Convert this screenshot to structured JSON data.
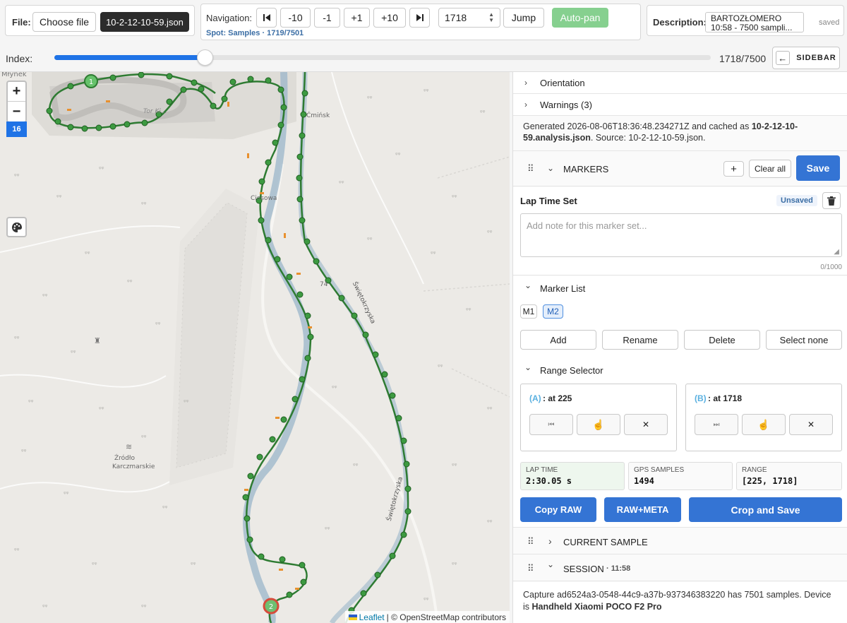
{
  "file": {
    "label": "File:",
    "choose_label": "Choose file",
    "filename": "10-2-12-10-59.json"
  },
  "nav": {
    "label": "Navigation:",
    "minus10": "-10",
    "minus1": "-1",
    "plus1": "+1",
    "plus10": "+10",
    "index_value": "1718",
    "jump": "Jump",
    "autopan": "Auto-pan",
    "spot": "Spot: Samples · 1719/7501"
  },
  "description": {
    "label": "Description:",
    "value": "BARTOZŁOMERO\n10:58 - 7500 sampli...",
    "status": "saved"
  },
  "index": {
    "label": "Index:",
    "position": "1718/7500",
    "fraction": 0.229,
    "sidebar_label": "SIDEBAR"
  },
  "map": {
    "zoom_level": "16",
    "attribution_leaflet": "Leaflet",
    "attribution_osm": "| © OpenStreetMap contributors",
    "marker1": "1",
    "marker2": "2",
    "places": {
      "mlynek": "Młynek",
      "tor": "Tor Ki...",
      "cminsk": "Ćmińsk",
      "ciosowa": "Ciosowa",
      "zrodlo": "Źródło",
      "karczmarskie": "Karczmarskie",
      "road1": "Świętokrzyska",
      "road2": "Świętokrzyska",
      "road74": "74"
    }
  },
  "sidebar": {
    "orientation": "Orientation",
    "warnings": "Warnings (3)",
    "generated_prefix": "Generated 2026-08-06T18:36:48.234271Z and cached as ",
    "generated_bold": "10-2-12-10-59.analysis.json",
    "generated_suffix": ". Source: 10-2-12-10-59.json.",
    "markers": {
      "title": "MARKERS",
      "add": "+",
      "clear": "Clear all",
      "save": "Save",
      "set_title": "Lap Time Set",
      "unsaved": "Unsaved",
      "note_placeholder": "Add note for this marker set...",
      "char_count": "0/1000",
      "list_title": "Marker List",
      "chips": [
        "M1",
        "M2"
      ],
      "actions": {
        "add": "Add",
        "rename": "Rename",
        "delete": "Delete",
        "select_none": "Select none"
      }
    },
    "range": {
      "title": "Range Selector",
      "a_tag": "(A)",
      "a_text": ": at 225",
      "b_tag": "(B)",
      "b_text": ": at 1718",
      "lap_time_label": "LAP TIME",
      "lap_time_value": "2:30.05 s",
      "gps_label": "GPS SAMPLES",
      "gps_value": "1494",
      "range_label": "RANGE",
      "range_value": "[225, 1718]",
      "copy_raw": "Copy RAW",
      "raw_meta": "RAW+META",
      "crop_save": "Crop and Save"
    },
    "current_sample": "CURRENT SAMPLE",
    "session": {
      "title": "SESSION",
      "time": "· 11:58",
      "text_prefix": "Capture ad6524a3-0548-44c9-a37b-937346383220 has 7501 samples. Device is ",
      "device": "Handheld Xiaomi POCO F2 Pro"
    }
  },
  "colors": {
    "accent": "#3474d4",
    "track": "#3a8a3a",
    "route": "#8fb3c9",
    "autopan": "#86d08f"
  }
}
